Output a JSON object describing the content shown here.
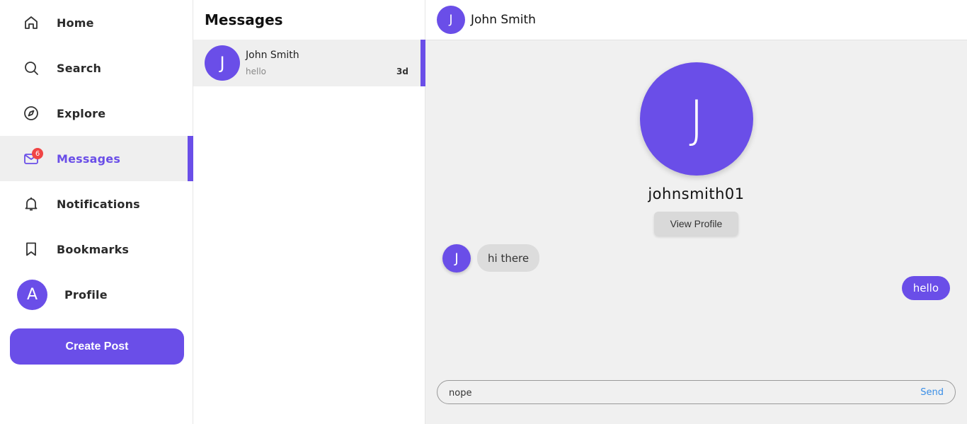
{
  "sidebar": {
    "items": [
      {
        "label": "Home",
        "icon": "home-icon"
      },
      {
        "label": "Search",
        "icon": "search-icon"
      },
      {
        "label": "Explore",
        "icon": "compass-icon"
      },
      {
        "label": "Messages",
        "icon": "mail-icon",
        "badge": "6",
        "active": true
      },
      {
        "label": "Notifications",
        "icon": "bell-icon"
      },
      {
        "label": "Bookmarks",
        "icon": "bookmark-icon"
      }
    ],
    "profile": {
      "label": "Profile",
      "avatar_letter": "A"
    },
    "create_post": "Create Post",
    "accent_color": "#6a4ee8",
    "badge_color": "#f04545"
  },
  "messages": {
    "title": "Messages",
    "conversations": [
      {
        "avatar_letter": "J",
        "name": "John Smith",
        "preview": "hello",
        "time": "3d"
      }
    ]
  },
  "chat": {
    "header": {
      "avatar_letter": "J",
      "name": "John Smith"
    },
    "profile": {
      "avatar_letter": "J",
      "username": "johnsmith01",
      "view_profile": "View Profile"
    },
    "thread": [
      {
        "direction": "in",
        "avatar_letter": "J",
        "text": "hi there"
      },
      {
        "direction": "out",
        "text": "hello"
      }
    ],
    "composer": {
      "value": "nope",
      "send_label": "Send"
    }
  }
}
